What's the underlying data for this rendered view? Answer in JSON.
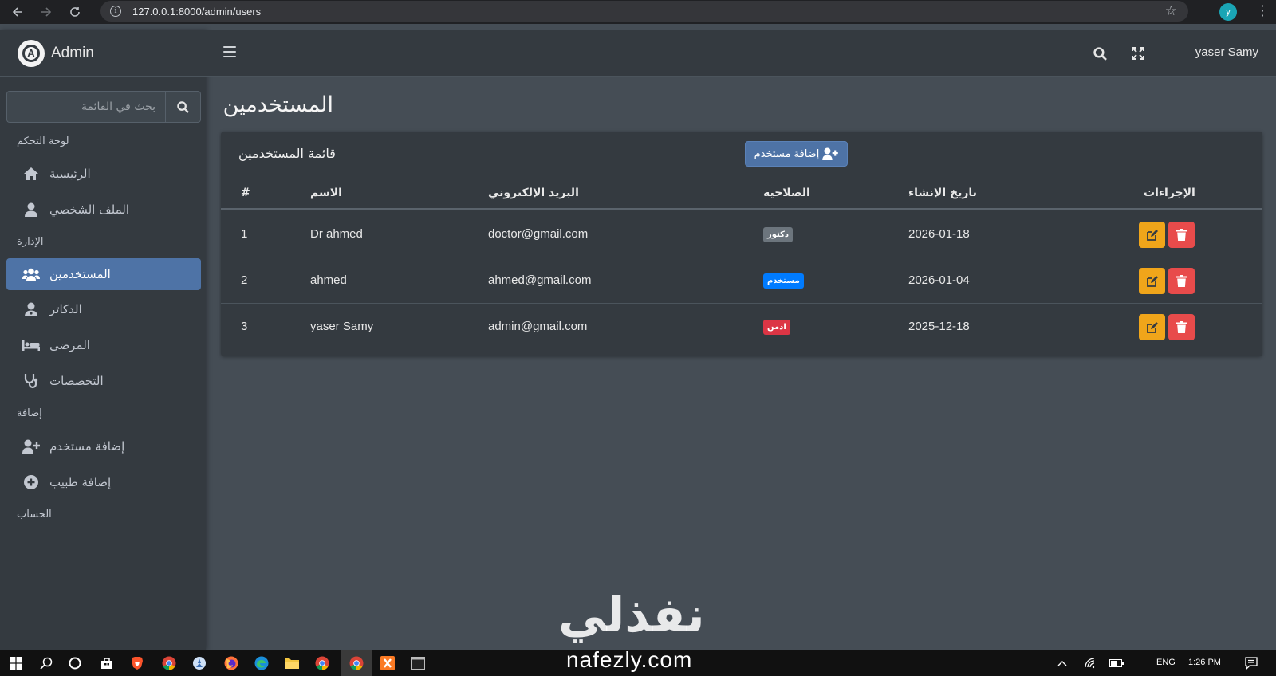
{
  "browser": {
    "url": "127.0.0.1:8000/admin/users",
    "profile_initial": "y"
  },
  "brand": {
    "name": "Admin",
    "logo_letter": "A"
  },
  "sidebar": {
    "search_placeholder": "بحث في القائمة",
    "headers": {
      "dashboard": "لوحة التحكم",
      "management": "الإدارة",
      "add": "إضافة",
      "account": "الحساب"
    },
    "items": {
      "home": "الرئيسية",
      "profile": "الملف الشخصي",
      "users": "المستخدمين",
      "doctors": "الدكاتر",
      "patients": "المرضى",
      "specialties": "التخصصات",
      "add_user": "إضافة مستخدم",
      "add_doctor": "إضافة طبيب"
    }
  },
  "topbar": {
    "user_name": "yaser Samy"
  },
  "page": {
    "title": "المستخدمين"
  },
  "card": {
    "title": "قائمة المستخدمين",
    "add_button": "إضافة مستخدم"
  },
  "table": {
    "headers": {
      "num": "#",
      "name": "الاسم",
      "email": "البريد الإلكتروني",
      "role": "الصلاحية",
      "created": "تاريخ الإنشاء",
      "actions": "الإجراءات"
    },
    "rows": [
      {
        "num": "1",
        "name": "Dr ahmed",
        "email": "doctor@gmail.com",
        "role": "دكتور",
        "role_color": "#6c757d",
        "created": "2026-01-18"
      },
      {
        "num": "2",
        "name": "ahmed",
        "email": "ahmed@gmail.com",
        "role": "مستخدم",
        "role_color": "#007bff",
        "created": "2026-01-04"
      },
      {
        "num": "3",
        "name": "yaser Samy",
        "email": "admin@gmail.com",
        "role": "ادمن",
        "role_color": "#dc3545",
        "created": "2025-12-18"
      }
    ]
  },
  "watermark": {
    "arabic": "نفذلي",
    "latin": "nafezly.com"
  },
  "taskbar": {
    "lang": "ENG",
    "time": "1:26 PM"
  },
  "colors": {
    "accent": "#4e73a6",
    "edit": "#f0a51a",
    "delete": "#e84b4b",
    "sidebar_bg": "#343a40",
    "content_bg": "#454d55"
  }
}
